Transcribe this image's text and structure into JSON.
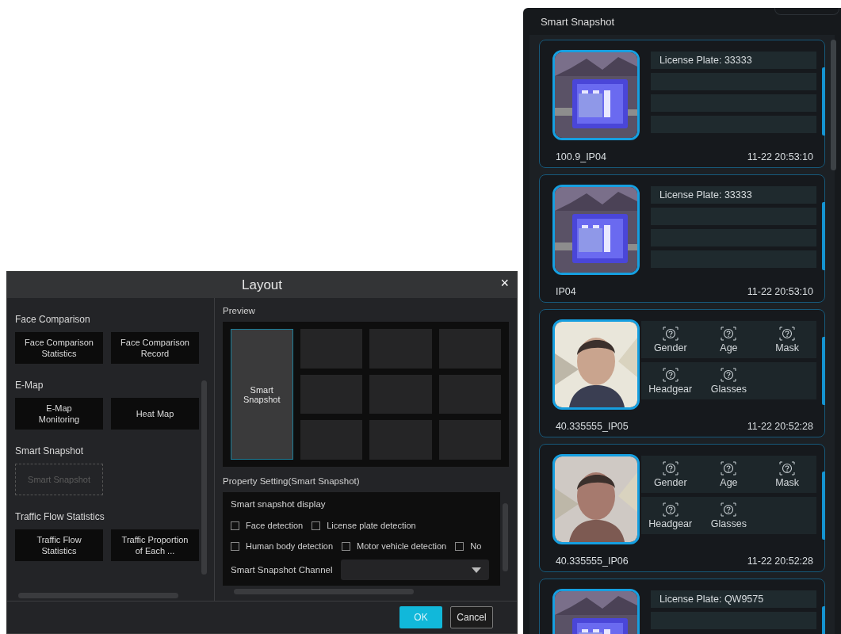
{
  "dialog": {
    "title": "Layout",
    "close": "×",
    "sections": [
      {
        "heading": "Face Comparison",
        "items": [
          {
            "label": "Face Comparison\nStatistics",
            "kind": "button"
          },
          {
            "label": "Face Comparison\nRecord",
            "kind": "button"
          }
        ]
      },
      {
        "heading": "E-Map",
        "items": [
          {
            "label": "E-Map\nMonitoring",
            "kind": "button"
          },
          {
            "label": "Heat Map",
            "kind": "button"
          }
        ]
      },
      {
        "heading": "Smart Snapshot",
        "items": [
          {
            "label": "Smart Snapshot",
            "kind": "placeholder"
          }
        ]
      },
      {
        "heading": "Traffic Flow Statistics",
        "items": [
          {
            "label": "Traffic Flow\nStatistics",
            "kind": "button"
          },
          {
            "label": "Traffic Proportion\nof Each ...",
            "kind": "button"
          }
        ]
      }
    ],
    "preview": {
      "label": "Preview",
      "main_cell": {
        "label": "Smart Snapshot",
        "selected": true
      },
      "cells": [
        {
          "selected": false
        },
        {
          "selected": false
        },
        {
          "selected": false
        },
        {
          "selected": false
        },
        {
          "selected": false
        },
        {
          "selected": false
        },
        {
          "selected": false
        },
        {
          "selected": false
        },
        {
          "selected": false
        }
      ]
    },
    "properties": {
      "label": "Property Setting(Smart Snapshot)",
      "display_label": "Smart snapshot display",
      "checkbox_rows": [
        [
          {
            "label": "Face detection",
            "checked": false
          },
          {
            "label": "License plate detection",
            "checked": false
          }
        ],
        [
          {
            "label": "Human body detection",
            "checked": false
          },
          {
            "label": "Motor vehicle detection",
            "checked": false
          },
          {
            "label": "No",
            "checked": false
          }
        ]
      ],
      "channel_label": "Smart Snapshot Channel"
    },
    "buttons": [
      {
        "label": "OK",
        "kind": "primary"
      },
      {
        "label": "Cancel",
        "kind": "secondary"
      }
    ]
  },
  "panel": {
    "title": "Smart Snapshot",
    "cards": [
      {
        "kind": "plate",
        "plate": "License Plate: 33333",
        "source": "100.9_IP04",
        "time": "11-22 20:53:10"
      },
      {
        "kind": "plate",
        "plate": "License Plate: 33333",
        "source": "IP04",
        "time": "11-22 20:53:10"
      },
      {
        "kind": "face",
        "attributes": [
          "Gender",
          "Age",
          "Mask",
          "Headgear",
          "Glasses"
        ],
        "source": "40.335555_IP05",
        "time": "11-22 20:52:28"
      },
      {
        "kind": "face",
        "attributes": [
          "Gender",
          "Age",
          "Mask",
          "Headgear",
          "Glasses"
        ],
        "source": "40.335555_IP06",
        "time": "11-22 20:52:28"
      },
      {
        "kind": "plate",
        "plate": "License Plate: QW9575"
      }
    ]
  }
}
